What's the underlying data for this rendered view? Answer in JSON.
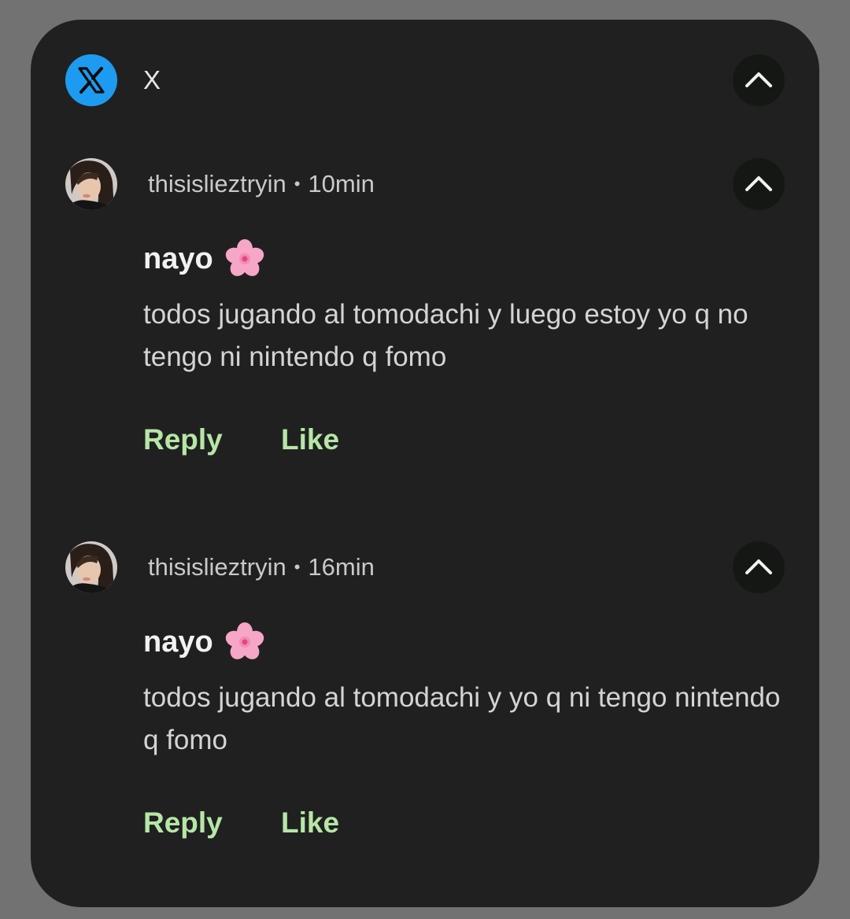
{
  "app": {
    "name": "X",
    "icon": "x-logo-icon",
    "accent": "#1d9bf0"
  },
  "messages": [
    {
      "account": "thisislieztryin",
      "separator": "•",
      "time": "10min",
      "sender": "nayo",
      "sender_emoji": "cherry-blossom-icon",
      "text": "todos jugando al tomodachi y luego estoy yo q no tengo ni nintendo q fomo",
      "reply_label": "Reply",
      "like_label": "Like"
    },
    {
      "account": "thisislieztryin",
      "separator": "•",
      "time": "16min",
      "sender": "nayo",
      "sender_emoji": "cherry-blossom-icon",
      "text": "todos jugando al tomodachi y yo q ni tengo nintendo q fomo",
      "reply_label": "Reply",
      "like_label": "Like"
    }
  ],
  "colors": {
    "card_bg": "#202020",
    "action": "#b6e6a6"
  }
}
